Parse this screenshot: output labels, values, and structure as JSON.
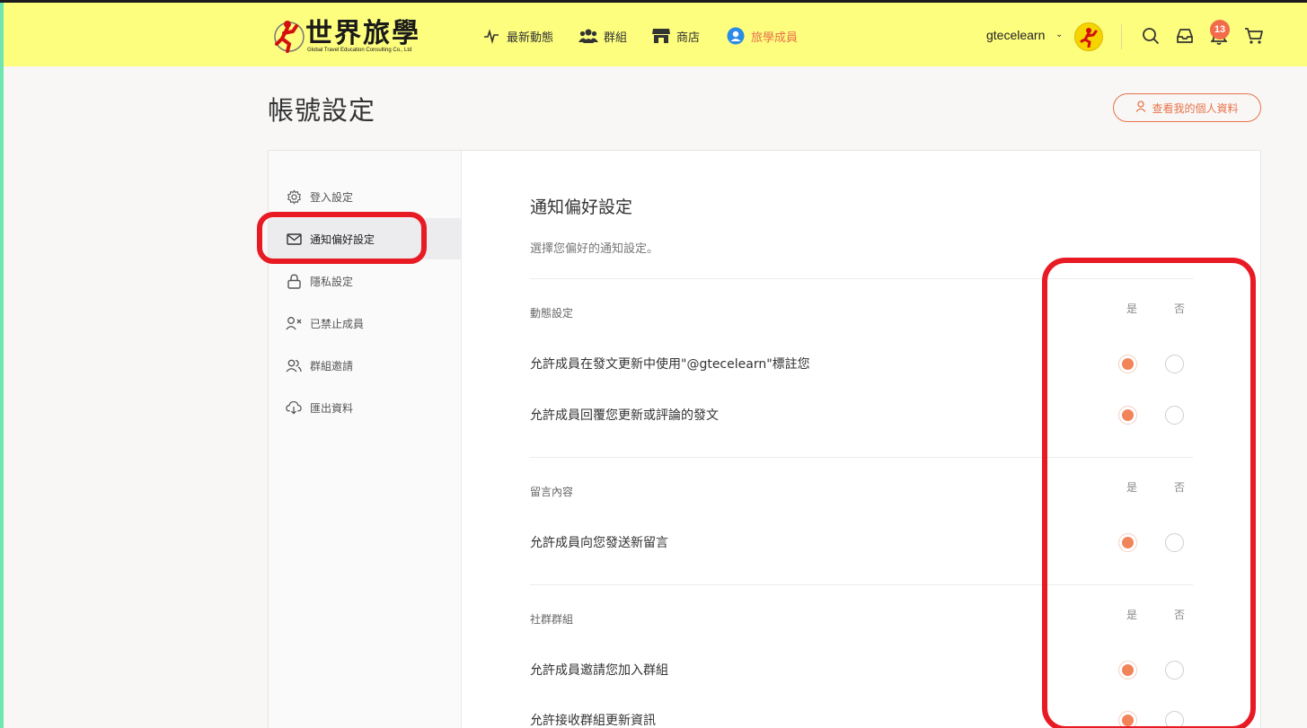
{
  "header": {
    "logo_text": "世界旅學",
    "logo_sub": "Global Travel Education Consulting Co., Ltd",
    "nav": [
      {
        "label": "最新動態",
        "icon": "activity-icon"
      },
      {
        "label": "群組",
        "icon": "group-icon"
      },
      {
        "label": "商店",
        "icon": "store-icon"
      },
      {
        "label": "旅學成員",
        "icon": "member-icon"
      }
    ],
    "username": "gtecelearn",
    "notification_count": "13",
    "colors": {
      "bar": "#fdfd7e",
      "accent": "#e8734a"
    }
  },
  "page": {
    "title": "帳號設定",
    "profile_button": "查看我的個人資料"
  },
  "sidebar": {
    "items": [
      {
        "label": "登入設定",
        "icon": "gear-icon"
      },
      {
        "label": "通知偏好設定",
        "icon": "mail-icon"
      },
      {
        "label": "隱私設定",
        "icon": "lock-icon"
      },
      {
        "label": "已禁止成員",
        "icon": "user-block-icon"
      },
      {
        "label": "群組邀請",
        "icon": "users-icon"
      },
      {
        "label": "匯出資料",
        "icon": "cloud-download-icon"
      }
    ]
  },
  "main": {
    "title": "通知偏好設定",
    "description": "選擇您偏好的通知設定。",
    "yes_label": "是",
    "no_label": "否",
    "groups": [
      {
        "label": "動態設定",
        "rows": [
          {
            "label": "允許成員在發文更新中使用\"@gtecelearn\"標註您",
            "value": "yes"
          },
          {
            "label": "允許成員回覆您更新或評論的發文",
            "value": "yes"
          }
        ]
      },
      {
        "label": "留言內容",
        "rows": [
          {
            "label": "允許成員向您發送新留言",
            "value": "yes"
          }
        ]
      },
      {
        "label": "社群群組",
        "rows": [
          {
            "label": "允許成員邀請您加入群組",
            "value": "yes"
          },
          {
            "label": "允許接收群組更新資訊",
            "value": "yes"
          }
        ]
      }
    ]
  },
  "annotations": {
    "color": "#e81b24"
  }
}
